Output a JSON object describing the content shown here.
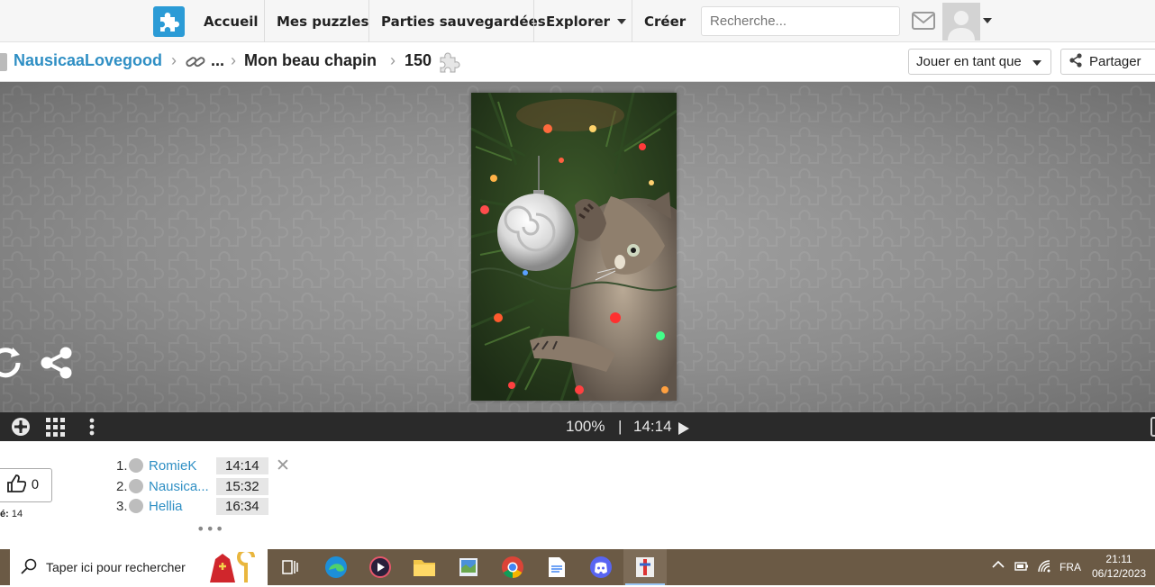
{
  "topnav": {
    "items": [
      "Accueil",
      "Mes puzzles",
      "Parties sauvegardées",
      "Explorer",
      "Créer"
    ],
    "search_placeholder": "Recherche..."
  },
  "breadcrumb": {
    "user": "NausicaaLovegood",
    "ellipsis": "...",
    "title": "Mon beau chapin",
    "pieces": "150"
  },
  "actions": {
    "play_as": "Jouer en tant que",
    "share": "Partager"
  },
  "controls": {
    "zoom": "100%",
    "separator": "|",
    "time": "14:14"
  },
  "likes": {
    "count": "0",
    "label": "é:",
    "value": "14"
  },
  "leaderboard": [
    {
      "rank": "1.",
      "name": "RomieK",
      "time": "14:14"
    },
    {
      "rank": "2.",
      "name": "Nausica...",
      "time": "15:32"
    },
    {
      "rank": "3.",
      "name": "Hellia",
      "time": "16:34"
    }
  ],
  "leaderboard_more": "•••",
  "taskbar": {
    "search_text": "Taper ici pour rechercher",
    "lang": "FRA",
    "time": "21:11",
    "date": "06/12/2023"
  },
  "colors": {
    "brand": "#2b9bd6",
    "link": "#2f8fc4",
    "taskbar": "#6b5a45"
  }
}
